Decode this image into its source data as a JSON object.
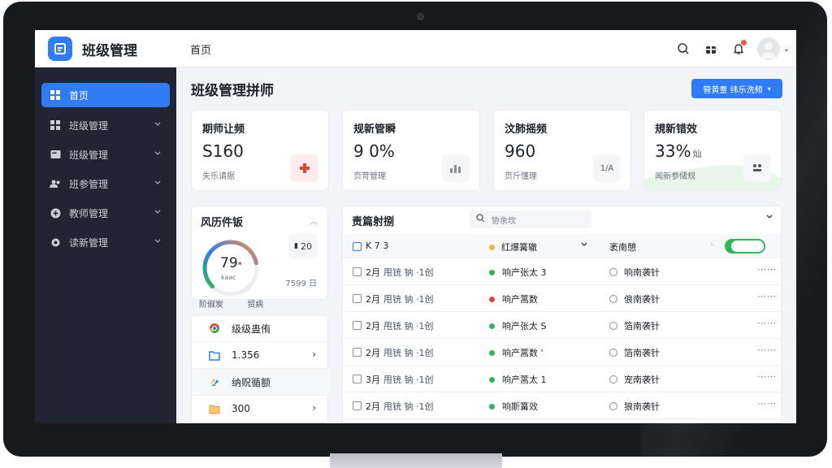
{
  "app": {
    "title": "班级管理",
    "breadcrumb": "首页"
  },
  "colors": {
    "accent": "#2f7cf6",
    "sidebar_bg": "#1f2533",
    "success": "#30b654",
    "danger": "#e0453a",
    "warning": "#f2b63c"
  },
  "header": {
    "icons": [
      "search-icon",
      "gift-icon",
      "bell-icon",
      "user-avatar"
    ]
  },
  "sidebar": {
    "items": [
      {
        "label": "首页",
        "icon": "grid-icon",
        "active": true
      },
      {
        "label": "班级管理",
        "icon": "grid-icon"
      },
      {
        "label": "班级管理",
        "icon": "card-icon"
      },
      {
        "label": "班参管理",
        "icon": "users-icon"
      },
      {
        "label": "教师管理",
        "icon": "plus-circle-icon"
      },
      {
        "label": "读新管理",
        "icon": "gear-icon"
      }
    ]
  },
  "main": {
    "title": "班级管理拼师",
    "action_label": "簪黄耋 纬乐洗频"
  },
  "stats": [
    {
      "label": "期师让频",
      "value": "S160",
      "suffix": "",
      "sub": "失乐请据",
      "icon": "plus-icon"
    },
    {
      "label": "规新管瞬",
      "value": "9 0%",
      "suffix": "",
      "sub": "页苛管理",
      "icon": "chart-icon"
    },
    {
      "label": "汶肺摇频",
      "value": "960",
      "suffix": "",
      "sub": "页斤懂理",
      "icon_text": "1/A"
    },
    {
      "label": "規新错效",
      "value": "33%",
      "suffix": "灿",
      "sub": "闻新参储规",
      "icon": "network-icon"
    }
  ],
  "risk": {
    "title": "风历件钣",
    "value": "79",
    "value_suffix": "*",
    "sub": "kaac",
    "gauge_percent": 79,
    "box_label": "20",
    "footer": "7599 日"
  },
  "tabs": [
    "阶俶炭",
    "贸病"
  ],
  "mini_list": [
    {
      "label": "级级蛊侑",
      "icon": "chrome-icon",
      "chevron": false
    },
    {
      "label": "1.356",
      "icon": "folder-blue-icon",
      "chevron": true
    },
    {
      "label": "纳贶循额",
      "icon": "palette-icon",
      "chevron": false
    },
    {
      "label": "300",
      "icon": "folder-orange-icon",
      "chevron": true
    }
  ],
  "table": {
    "title": "责篇射捌",
    "search_placeholder": "协余坎",
    "header": {
      "col1": "K 7 3",
      "col2": "红爆篝辙",
      "col3": "袤南憩",
      "toggle_on": true
    },
    "rows": [
      {
        "date": "2月",
        "name": "甩铳 钠 ·1创",
        "status_color": "#30b654",
        "status": "响产张太 3",
        "teacher": "响南袭针"
      },
      {
        "date": "2月",
        "name": "甩铳 钠 ·1创",
        "status_color": "#e0453a",
        "status": "响产蒿数",
        "teacher": "俍南袭针"
      },
      {
        "date": "2月",
        "name": "甩铳 钠 ·1创",
        "status_color": "#30b654",
        "status": "响产张太 S",
        "teacher": "箔南袭针"
      },
      {
        "date": "2月",
        "name": "甩铳 钠 ·1创",
        "status_color": "#30b654",
        "status": "响产蒿数 '",
        "teacher": "箔南袭针"
      },
      {
        "date": "3月",
        "name": "甩铳 钠 ·1创",
        "status_color": "#30b654",
        "status": "响产蒿太 1",
        "teacher": "宠南袭针"
      },
      {
        "date": "2月",
        "name": "甩铳 钠 ·1创",
        "status_color": "#30b654",
        "status": "响斯篝效",
        "teacher": "狼南袭针"
      }
    ]
  }
}
